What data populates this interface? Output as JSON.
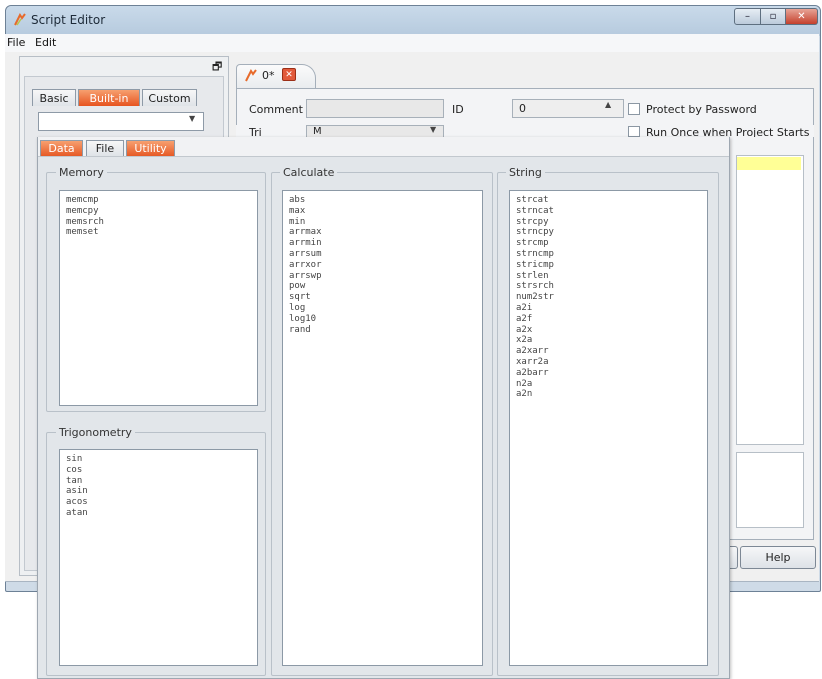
{
  "window": {
    "title": "Script Editor",
    "min_glyph": "–",
    "max_glyph": "▫",
    "close_glyph": "✕"
  },
  "menu": {
    "file": "File",
    "edit": "Edit"
  },
  "left_tabs": {
    "basic": "Basic",
    "builtin": "Built-in",
    "custom": "Custom"
  },
  "script_tab": {
    "label": "0*"
  },
  "form": {
    "comment_label": "Comment",
    "id_label": "ID",
    "id_value": "0",
    "protect_label": "Protect by Password",
    "trigger_label": "Tri",
    "trigger_value": "M",
    "run_label": "Run Once when Project Starts"
  },
  "help_button": "Help",
  "popup": {
    "tabs": {
      "data": "Data",
      "file": "File",
      "utility": "Utility"
    },
    "memory": {
      "title": "Memory",
      "items": [
        "memcmp",
        "memcpy",
        "memsrch",
        "memset"
      ]
    },
    "trigonometry": {
      "title": "Trigonometry",
      "items": [
        "sin",
        "cos",
        "tan",
        "asin",
        "acos",
        "atan"
      ]
    },
    "calculate": {
      "title": "Calculate",
      "items": [
        "abs",
        "max",
        "min",
        "arrmax",
        "arrmin",
        "arrsum",
        "arrxor",
        "arrswp",
        "pow",
        "sqrt",
        "log",
        "log10",
        "rand"
      ]
    },
    "string": {
      "title": "String",
      "items": [
        "strcat",
        "strncat",
        "strcpy",
        "strncpy",
        "strcmp",
        "strncmp",
        "stricmp",
        "strlen",
        "strsrch",
        "num2str",
        "a2i",
        "a2f",
        "a2x",
        "x2a",
        "a2xarr",
        "xarr2a",
        "a2barr",
        "n2a",
        "a2n"
      ]
    }
  },
  "colors": {
    "accent_orange": "#e75420",
    "highlight_yellow": "#ffff96",
    "close_red": "#c5402c"
  }
}
